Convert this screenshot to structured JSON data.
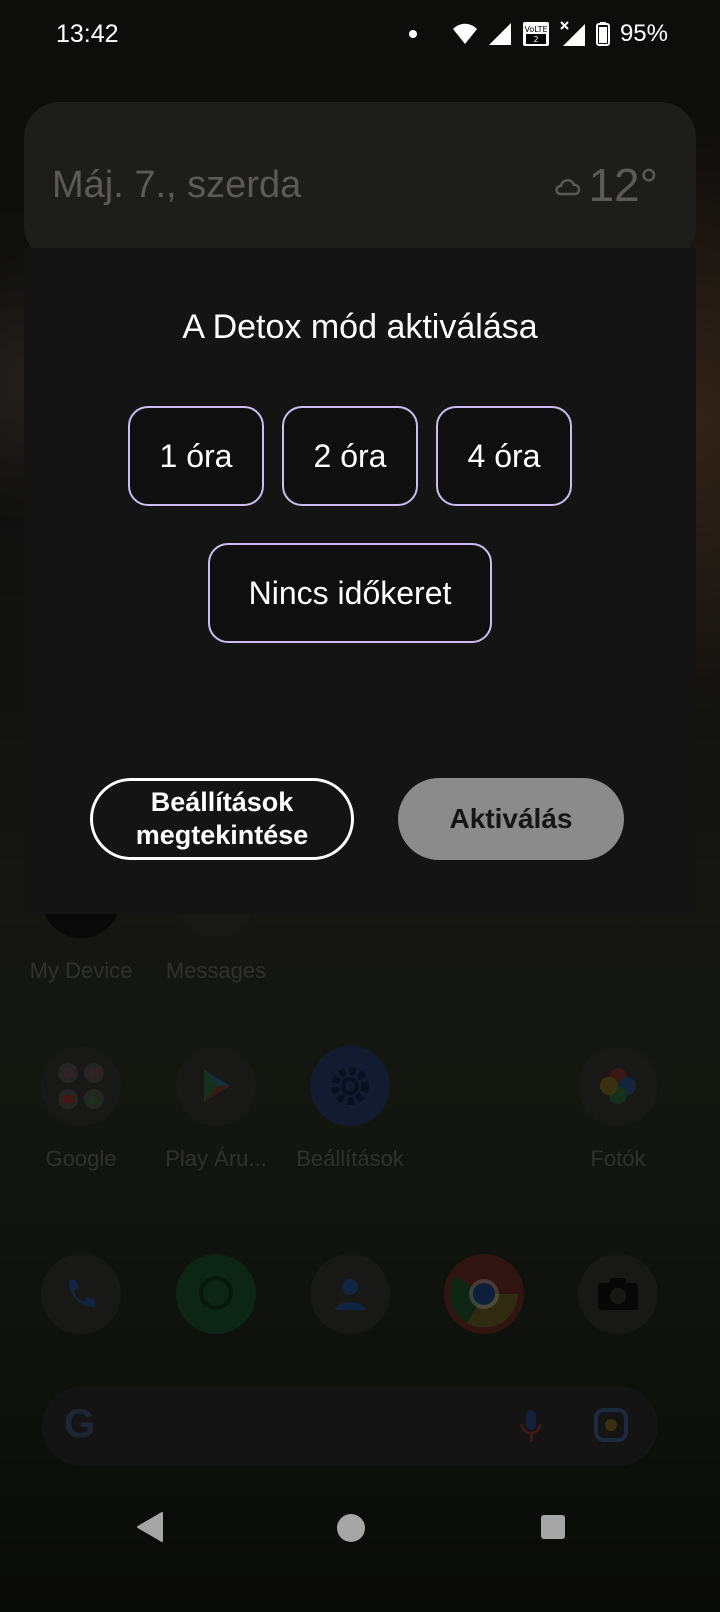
{
  "status_bar": {
    "time": "13:42",
    "battery": "95%"
  },
  "widget": {
    "date": "Máj. 7., szerda",
    "temperature": "12°"
  },
  "dialog": {
    "title": "A Detox mód aktiválása",
    "options": [
      "1 óra",
      "2 óra",
      "4 óra",
      "Nincs időkeret"
    ],
    "settings_button_line1": "Beállítások",
    "settings_button_line2": "megtekintése",
    "activate_button": "Aktiválás"
  },
  "apps": [
    {
      "label": "My Device",
      "icon": "hmd-icon"
    },
    {
      "label": "Messages",
      "icon": "messages-icon"
    },
    {
      "label": "Google",
      "icon": "google-folder-icon"
    },
    {
      "label": "Play Áru...",
      "icon": "play-store-icon"
    },
    {
      "label": "Beállítások",
      "icon": "settings-gear-icon"
    },
    {
      "label": "Fotók",
      "icon": "photos-icon"
    }
  ],
  "dock": [
    "phone-icon",
    "whatsapp-icon",
    "contacts-icon",
    "chrome-icon",
    "camera-icon"
  ],
  "colors": {
    "option_border": "#cbbcf2",
    "activate_bg": "#8b8b8b",
    "dialog_bg": "#141414"
  }
}
